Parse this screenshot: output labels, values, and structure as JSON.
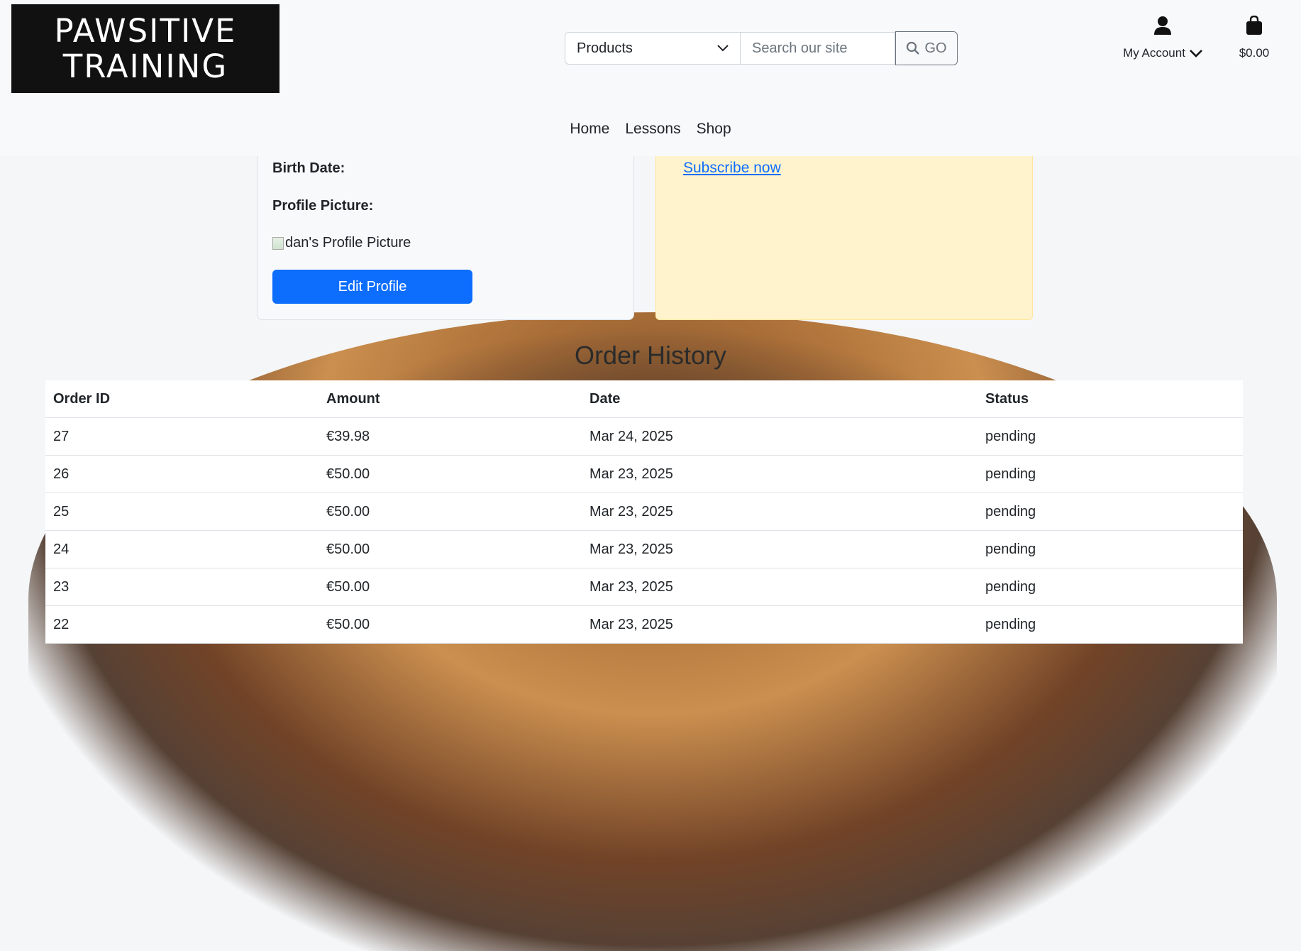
{
  "logo": {
    "line1": "PAWSITIVE",
    "line2": "TRAINING"
  },
  "search": {
    "category_selected": "Products",
    "placeholder": "Search our site",
    "go_label": "GO"
  },
  "account": {
    "label": "My Account"
  },
  "cart": {
    "total": "$0.00"
  },
  "nav": {
    "items": [
      {
        "label": "Home"
      },
      {
        "label": "Lessons"
      },
      {
        "label": "Shop"
      }
    ]
  },
  "profile": {
    "birth_date_label": "Birth Date:",
    "profile_picture_label": "Profile Picture:",
    "picture_alt": "dan's Profile Picture",
    "edit_button": "Edit Profile"
  },
  "subscription": {
    "link": "Subscribe now"
  },
  "orders": {
    "title": "Order History",
    "headers": [
      "Order ID",
      "Amount",
      "Date",
      "Status"
    ],
    "rows": [
      {
        "id": "27",
        "amount": "€39.98",
        "date": "Mar 24, 2025",
        "status": "pending"
      },
      {
        "id": "26",
        "amount": "€50.00",
        "date": "Mar 23, 2025",
        "status": "pending"
      },
      {
        "id": "25",
        "amount": "€50.00",
        "date": "Mar 23, 2025",
        "status": "pending"
      },
      {
        "id": "24",
        "amount": "€50.00",
        "date": "Mar 23, 2025",
        "status": "pending"
      },
      {
        "id": "23",
        "amount": "€50.00",
        "date": "Mar 23, 2025",
        "status": "pending"
      },
      {
        "id": "22",
        "amount": "€50.00",
        "date": "Mar 23, 2025",
        "status": "pending"
      }
    ]
  },
  "colors": {
    "primary": "#0d6efd",
    "warning_bg": "#fff3cd",
    "header_bg": "#f8f9fa"
  }
}
